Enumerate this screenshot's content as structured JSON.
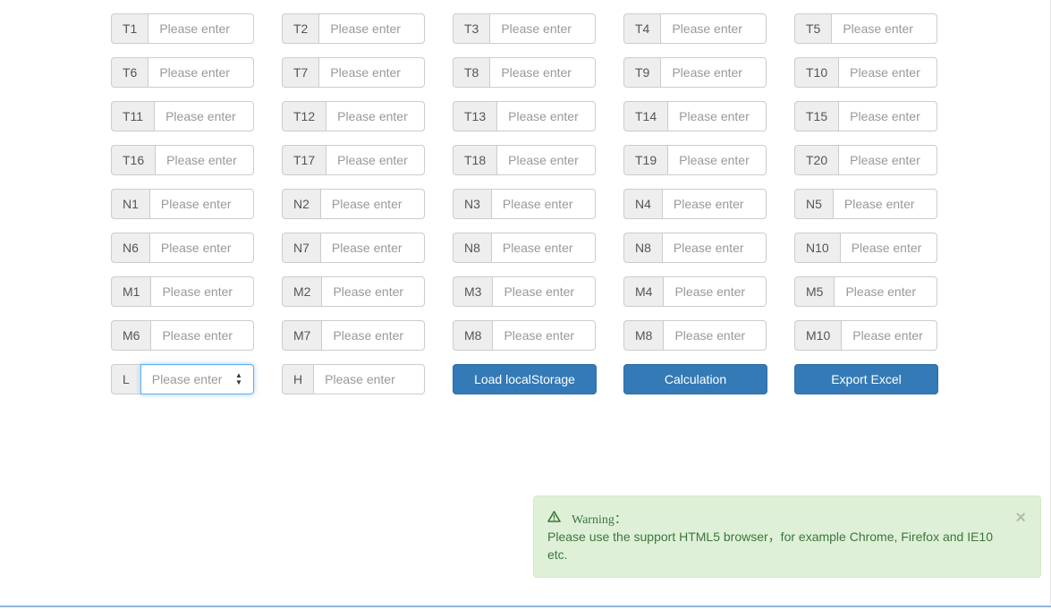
{
  "placeholder": "Please enter",
  "rows": [
    [
      "T1",
      "T2",
      "T3",
      "T4",
      "T5"
    ],
    [
      "T6",
      "T7",
      "T8",
      "T9",
      "T10"
    ],
    [
      "T11",
      "T12",
      "T13",
      "T14",
      "T15"
    ],
    [
      "T16",
      "T17",
      "T18",
      "T19",
      "T20"
    ],
    [
      "N1",
      "N2",
      "N3",
      "N4",
      "N5"
    ],
    [
      "N6",
      "N7",
      "N8",
      "N8",
      "N10"
    ],
    [
      "M1",
      "M2",
      "M3",
      "M4",
      "M5"
    ],
    [
      "M6",
      "M7",
      "M8",
      "M8",
      "M10"
    ]
  ],
  "last_row": {
    "l_label": "L",
    "h_label": "H",
    "load_button": "Load localStorage",
    "calc_button": "Calculation",
    "export_button": "Export Excel"
  },
  "alert": {
    "title": "Warning：",
    "message": "Please use the support HTML5 browser，for example Chrome, Firefox and IE10 etc.",
    "close": "×",
    "icon": "warning-triangle-icon"
  },
  "colors": {
    "primary": "#337ab7",
    "alert_bg": "#dff0d8",
    "alert_text": "#3c763d",
    "focus": "#66afe9"
  }
}
